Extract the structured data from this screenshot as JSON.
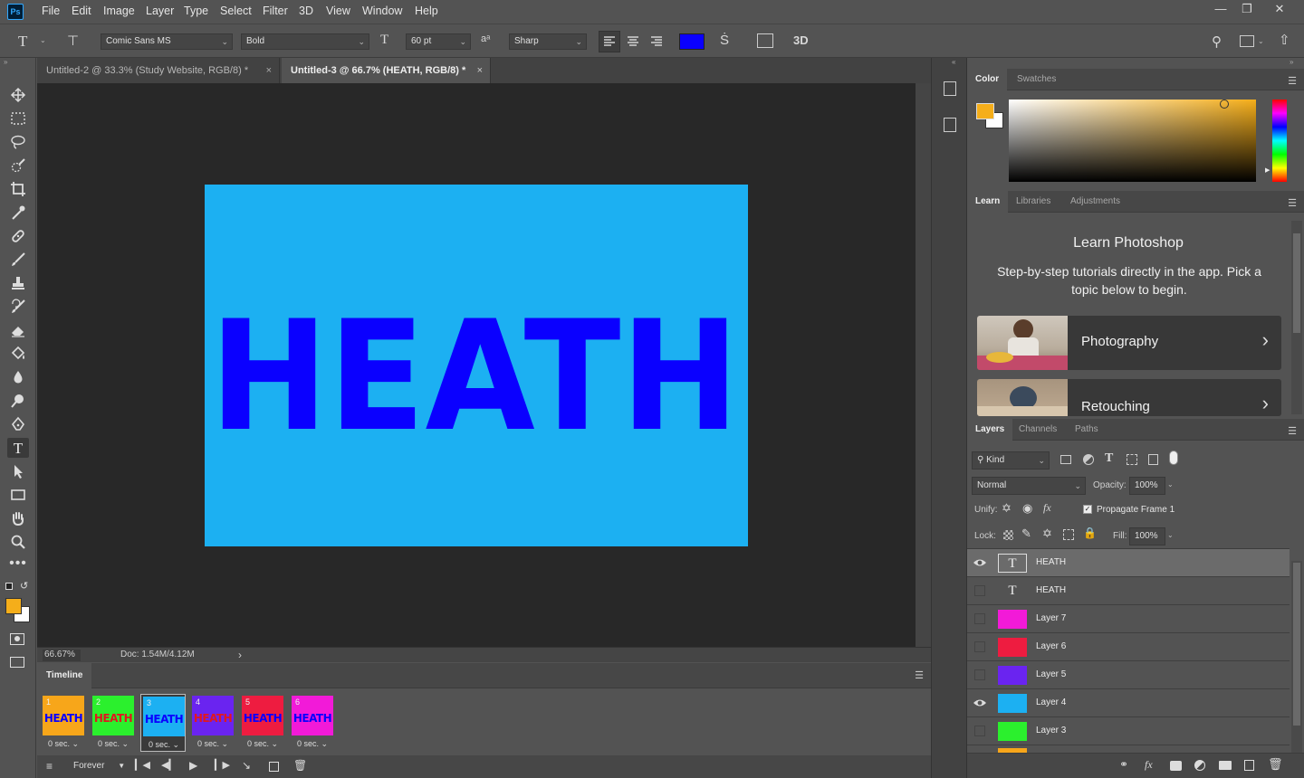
{
  "app": {
    "logo": "Ps"
  },
  "menu": [
    "File",
    "Edit",
    "Image",
    "Layer",
    "Type",
    "Select",
    "Filter",
    "3D",
    "View",
    "Window",
    "Help"
  ],
  "options": {
    "font_family": "Comic Sans MS",
    "font_style": "Bold",
    "font_size": "60 pt",
    "antialias": "Sharp",
    "text_color": "#0a00ff",
    "three_d": "3D"
  },
  "tabs": [
    {
      "label": "Untitled-2 @ 33.3% (Study Website, RGB/8) *"
    },
    {
      "label": "Untitled-3 @ 66.7% (HEATH, RGB/8) *"
    }
  ],
  "canvas": {
    "text": "HEATH",
    "bg_color": "#1cb0f2",
    "text_color": "#0a00ff"
  },
  "status": {
    "zoom": "66.67%",
    "doc": "Doc: 1.54M/4.12M"
  },
  "timeline": {
    "title": "Timeline",
    "loop": "Forever",
    "frames": [
      {
        "num": "1",
        "text": "HEATH",
        "bg": "#f7a61a",
        "fg": "#0a00ff",
        "delay": "0 sec."
      },
      {
        "num": "2",
        "text": "HEATH",
        "bg": "#2bf02d",
        "fg": "#e0181f",
        "delay": "0 sec."
      },
      {
        "num": "3",
        "text": "HEATH",
        "bg": "#1cb0f2",
        "fg": "#0a00ff",
        "delay": "0 sec."
      },
      {
        "num": "4",
        "text": "HEATH",
        "bg": "#6a24f0",
        "fg": "#e0181f",
        "delay": "0 sec."
      },
      {
        "num": "5",
        "text": "HEATH",
        "bg": "#ee1c40",
        "fg": "#0a00ff",
        "delay": "0 sec."
      },
      {
        "num": "6",
        "text": "HEATH",
        "bg": "#f21ad8",
        "fg": "#0a00ff",
        "delay": "0 sec."
      }
    ]
  },
  "color_panel": {
    "tabs": [
      "Color",
      "Swatches"
    ],
    "foreground": "#f5ae1a",
    "background": "#ffffff"
  },
  "learn_panel": {
    "tabs": [
      "Learn",
      "Libraries",
      "Adjustments"
    ],
    "title": "Learn Photoshop",
    "description": "Step-by-step tutorials directly in the app. Pick a topic below to begin.",
    "cards": [
      "Photography",
      "Retouching"
    ]
  },
  "layers_panel": {
    "tabs": [
      "Layers",
      "Channels",
      "Paths"
    ],
    "kind": "Kind",
    "blend_mode": "Normal",
    "opacity_label": "Opacity:",
    "opacity": "100%",
    "unify_label": "Unify:",
    "propagate": "Propagate Frame 1",
    "lock_label": "Lock:",
    "fill_label": "Fill:",
    "fill": "100%",
    "layers": [
      {
        "name": "HEATH",
        "type": "text",
        "visible": true,
        "color": ""
      },
      {
        "name": "HEATH",
        "type": "text",
        "visible": false,
        "color": ""
      },
      {
        "name": "Layer 7",
        "type": "fill",
        "visible": false,
        "color": "#f21ad8"
      },
      {
        "name": "Layer 6",
        "type": "fill",
        "visible": false,
        "color": "#ee1c40"
      },
      {
        "name": "Layer 5",
        "type": "fill",
        "visible": false,
        "color": "#6a24f0"
      },
      {
        "name": "Layer 4",
        "type": "fill",
        "visible": true,
        "color": "#1cb0f2"
      },
      {
        "name": "Layer 3",
        "type": "fill",
        "visible": false,
        "color": "#2bf02d"
      }
    ]
  }
}
